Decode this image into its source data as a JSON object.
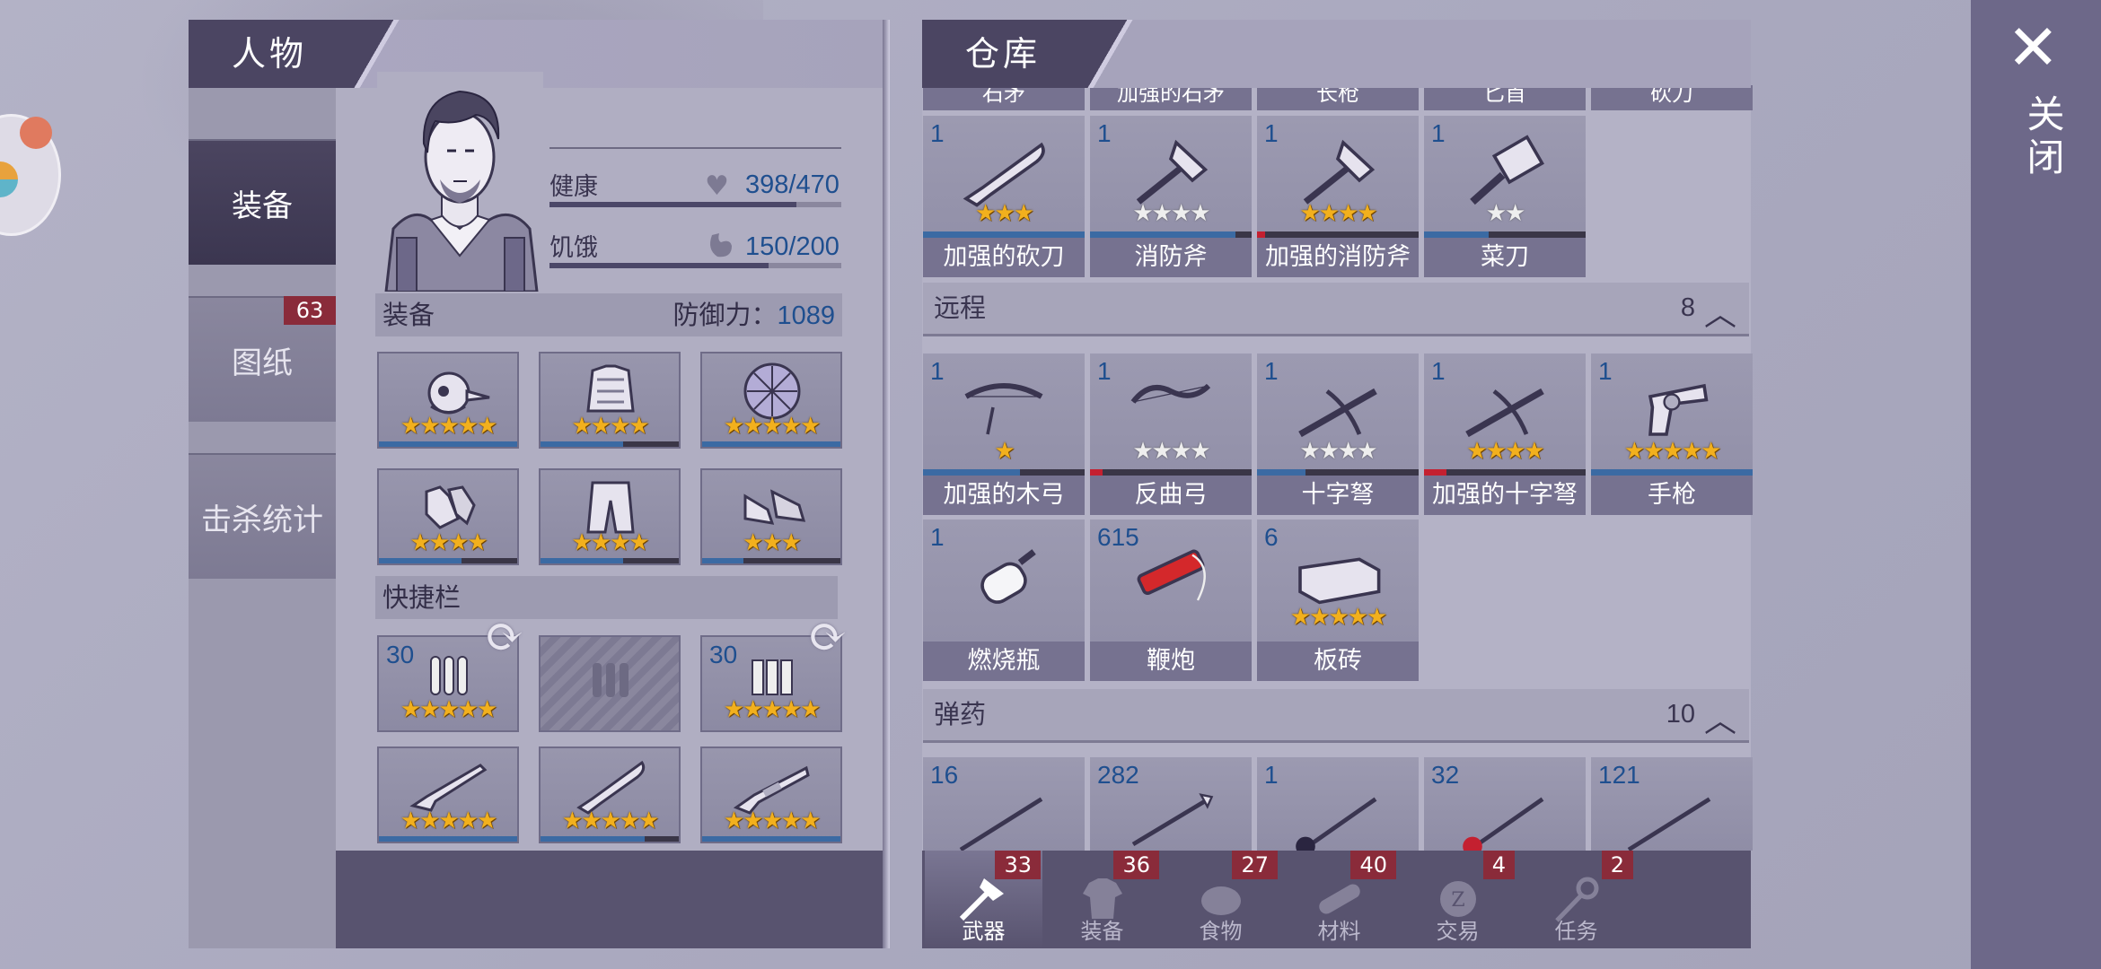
{
  "character_panel": {
    "title": "人物",
    "tabs": [
      {
        "label": "装备"
      },
      {
        "label": "图纸",
        "badge": "63"
      },
      {
        "label": "击杀统计"
      }
    ],
    "health_label": "健康",
    "health_value": "398/470",
    "health_fraction": 0.847,
    "hunger_label": "饥饿",
    "hunger_value": "150/200",
    "hunger_fraction": 0.75,
    "equipment_label": "装备",
    "defense_label": "防御力：",
    "defense_value": "1089",
    "equipment_slots": [
      {
        "icon": "helmet-icon",
        "stars": 5,
        "white_stars": 0,
        "durability": 1.0
      },
      {
        "icon": "armor-vest-icon",
        "stars": 4,
        "white_stars": 0,
        "durability": 0.6
      },
      {
        "icon": "turtle-shell-icon",
        "stars": 5,
        "white_stars": 0,
        "durability": 1.0
      },
      {
        "icon": "gloves-icon",
        "stars": 4,
        "white_stars": 0,
        "durability": 0.6
      },
      {
        "icon": "pants-icon",
        "stars": 4,
        "white_stars": 0,
        "durability": 0.6
      },
      {
        "icon": "shoes-icon",
        "stars": 3,
        "white_stars": 0,
        "durability": 0.3
      }
    ],
    "quickbar_label": "快捷栏",
    "quickbar_slots": [
      {
        "icon": "bullets-icon",
        "qty": "30",
        "stars": 5,
        "white_stars": 0,
        "durability": 0
      },
      {
        "icon": "empty-bullets-icon",
        "qty": "",
        "stars": 0,
        "white_stars": 0,
        "durability": 0
      },
      {
        "icon": "shells-icon",
        "qty": "30",
        "stars": 5,
        "white_stars": 0,
        "durability": 0
      },
      {
        "icon": "rifle-icon",
        "qty": "",
        "stars": 5,
        "white_stars": 0,
        "durability": 1.0
      },
      {
        "icon": "machete-icon",
        "qty": "",
        "stars": 5,
        "white_stars": 0,
        "durability": 0.75
      },
      {
        "icon": "shotgun-icon",
        "qty": "",
        "stars": 5,
        "white_stars": 0,
        "durability": 1.0
      }
    ]
  },
  "warehouse": {
    "title": "仓库",
    "top_partial_labels": [
      "石矛",
      "加强的石矛",
      "长枪",
      "匕首",
      "砍刀"
    ],
    "melee_items": [
      {
        "qty": "1",
        "name": "加强的砍刀",
        "icon": "machete-icon",
        "stars": 3,
        "white_stars": 0,
        "durability": 1.0,
        "red": false
      },
      {
        "qty": "1",
        "name": "消防斧",
        "icon": "fire-axe-icon",
        "stars": 0,
        "white_stars": 4,
        "durability": 0.9,
        "red": false
      },
      {
        "qty": "1",
        "name": "加强的消防斧",
        "icon": "fire-axe-icon",
        "stars": 4,
        "white_stars": 0,
        "durability": 0.05,
        "red": true
      },
      {
        "qty": "1",
        "name": "菜刀",
        "icon": "cleaver-icon",
        "stars": 0,
        "white_stars": 2,
        "durability": 0.4,
        "red": false
      }
    ],
    "ranged_label": "远程",
    "ranged_count": "8",
    "ranged_items": [
      {
        "qty": "1",
        "name": "加强的木弓",
        "icon": "wooden-bow-icon",
        "stars": 1,
        "white_stars": 0,
        "durability": 0.6,
        "red": false
      },
      {
        "qty": "1",
        "name": "反曲弓",
        "icon": "recurve-bow-icon",
        "stars": 0,
        "white_stars": 4,
        "durability": 0.08,
        "red": true
      },
      {
        "qty": "1",
        "name": "十字弩",
        "icon": "crossbow-icon",
        "stars": 0,
        "white_stars": 4,
        "durability": 0.3,
        "red": false
      },
      {
        "qty": "1",
        "name": "加强的十字弩",
        "icon": "crossbow-icon",
        "stars": 4,
        "white_stars": 0,
        "durability": 0.14,
        "red": true
      },
      {
        "qty": "1",
        "name": "手枪",
        "icon": "revolver-icon",
        "stars": 5,
        "white_stars": 0,
        "durability": 1.0,
        "red": false
      },
      {
        "qty": "1",
        "name": "燃烧瓶",
        "icon": "molotov-icon",
        "stars": 0,
        "white_stars": 0,
        "durability": 0,
        "red": false
      },
      {
        "qty": "615",
        "name": "鞭炮",
        "icon": "firecracker-icon",
        "stars": 0,
        "white_stars": 0,
        "durability": 0,
        "red": false
      },
      {
        "qty": "6",
        "name": "板砖",
        "icon": "brick-icon",
        "stars": 5,
        "white_stars": 0,
        "durability": 0,
        "red": false
      }
    ],
    "ammo_label": "弹药",
    "ammo_count": "10",
    "ammo_items": [
      {
        "qty": "16",
        "icon": "spear-ammo-icon"
      },
      {
        "qty": "282",
        "icon": "arrow-icon"
      },
      {
        "qty": "1",
        "icon": "poison-spear-icon"
      },
      {
        "qty": "32",
        "icon": "fire-spear-icon"
      },
      {
        "qty": "121",
        "icon": "spear-ammo-icon"
      }
    ],
    "bottom_tabs": [
      {
        "label": "武器",
        "badge": "33",
        "icon": "axe-icon"
      },
      {
        "label": "装备",
        "badge": "36",
        "icon": "shirt-icon"
      },
      {
        "label": "食物",
        "badge": "27",
        "icon": "meat-icon"
      },
      {
        "label": "材料",
        "badge": "40",
        "icon": "log-icon"
      },
      {
        "label": "交易",
        "badge": "4",
        "icon": "coin-icon"
      },
      {
        "label": "任务",
        "badge": "2",
        "icon": "key-icon"
      }
    ]
  },
  "close_label": "关闭",
  "close_icon": "close-icon"
}
